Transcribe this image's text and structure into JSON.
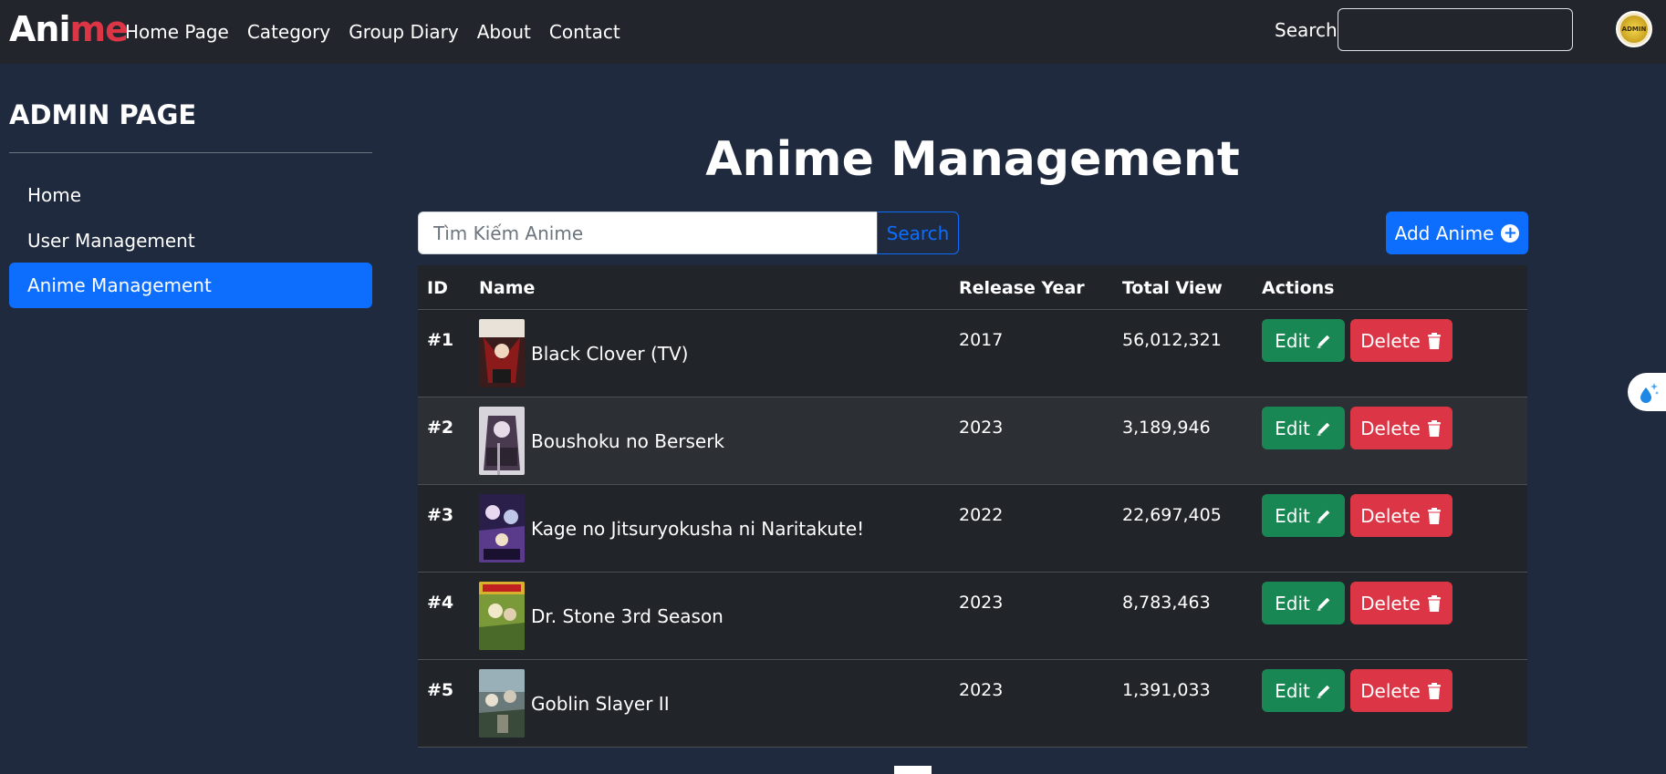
{
  "navbar": {
    "brand_part1": "Ani",
    "brand_part2": "me",
    "links": [
      "Home Page",
      "Category",
      "Group Diary",
      "About",
      "Contact"
    ],
    "search_label": "Search",
    "avatar_text": "ADMIN"
  },
  "sidebar": {
    "title": "ADMIN PAGE",
    "items": [
      {
        "label": "Home",
        "active": false
      },
      {
        "label": "User Management",
        "active": false
      },
      {
        "label": "Anime Management",
        "active": true
      }
    ]
  },
  "main": {
    "title": "Anime Management",
    "search_placeholder": "Tìm Kiếm Anime",
    "search_button": "Search",
    "add_button": "Add Anime"
  },
  "table": {
    "headers": [
      "ID",
      "Name",
      "Release Year",
      "Total View",
      "Actions"
    ],
    "edit_label": "Edit",
    "delete_label": "Delete",
    "rows": [
      {
        "id": "#1",
        "name": "Black Clover (TV)",
        "year": "2017",
        "views": "56,012,321"
      },
      {
        "id": "#2",
        "name": "Boushoku no Berserk",
        "year": "2023",
        "views": "3,189,946"
      },
      {
        "id": "#3",
        "name": "Kage no Jitsuryokusha ni Naritakute!",
        "year": "2022",
        "views": "22,697,405"
      },
      {
        "id": "#4",
        "name": "Dr. Stone 3rd Season",
        "year": "2023",
        "views": "8,783,463"
      },
      {
        "id": "#5",
        "name": "Goblin Slayer II",
        "year": "2023",
        "views": "1,391,033"
      }
    ]
  },
  "colors": {
    "background": "#1f2a3e",
    "navbar": "#22262c",
    "primary": "#0d6efd",
    "success": "#198754",
    "danger": "#dc3545",
    "table": "#212529"
  }
}
